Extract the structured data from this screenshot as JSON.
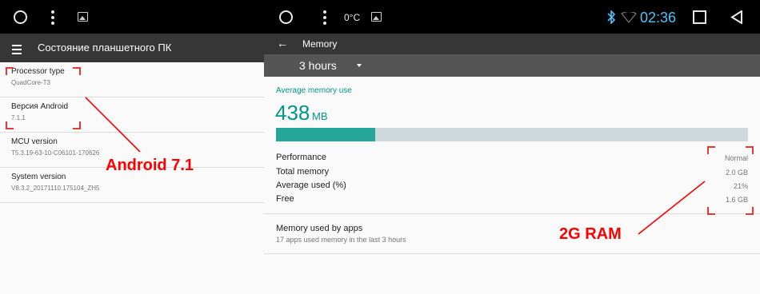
{
  "left": {
    "appbar_title": "Состояние планшетного ПК",
    "rows": [
      {
        "title": "Processor type",
        "value": "QuadCore-T3"
      },
      {
        "title": "Версия Android",
        "value": "7.1.1"
      },
      {
        "title": "MCU version",
        "value": "T5.3.19-63-10-C06101-170626"
      },
      {
        "title": "System version",
        "value": "V8.3.2_20171110.175104_ZH5"
      }
    ],
    "annotation": "Android 7.1"
  },
  "right": {
    "status": {
      "temperature": "0°C",
      "time": "02:36",
      "time_color": "#4fc3f7"
    },
    "appbar_title": "Memory",
    "period": "3 hours",
    "avg_label": "Average memory use",
    "avg_value": "438",
    "avg_unit": "MB",
    "usage_fraction": 0.21,
    "stats": [
      {
        "label": "Performance",
        "value": "Normal"
      },
      {
        "label": "Total memory",
        "value": "2.0 GB"
      },
      {
        "label": "Average used (%)",
        "value": "21%"
      },
      {
        "label": "Free",
        "value": "1.6 GB"
      }
    ],
    "apps_title": "Memory used by apps",
    "apps_sub": "17 apps used memory in the last 3 hours",
    "annotation": "2G RAM"
  },
  "colors": {
    "accent": "#009688",
    "annotation": "#ff0000",
    "appbar": "#363636"
  }
}
